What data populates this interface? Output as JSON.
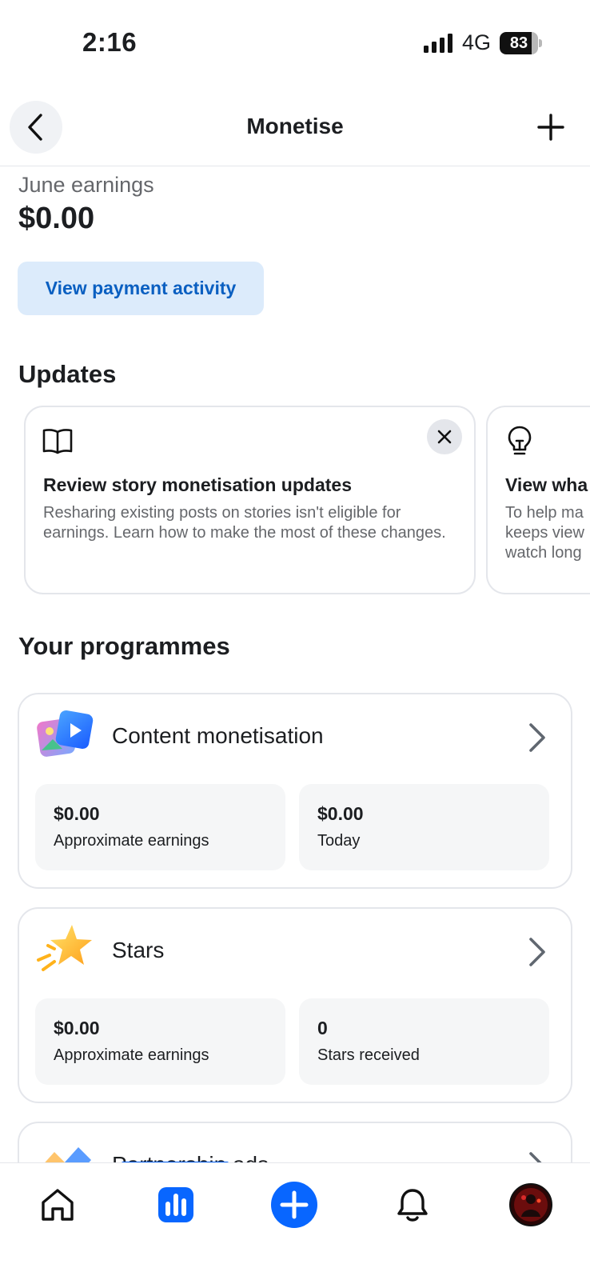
{
  "status_bar": {
    "time": "2:16",
    "network": "4G",
    "battery": "83",
    "battery_level_percent": 83
  },
  "header": {
    "title": "Monetise",
    "back_icon": "chevron-left-icon",
    "add_icon": "plus-icon"
  },
  "earnings": {
    "label": "June earnings",
    "value": "$0.00",
    "button_label": "View payment activity"
  },
  "updates": {
    "title": "Updates",
    "cards": [
      {
        "icon": "book-icon",
        "title": "Review story monetisation updates",
        "body": "Resharing existing posts on stories isn't eligible for earnings. Learn how to make the most of these changes."
      },
      {
        "icon": "lightbulb-icon",
        "title": "View wha",
        "body": "To help ma\nkeeps view\nwatch long"
      }
    ]
  },
  "programmes": {
    "title": "Your programmes",
    "items": [
      {
        "name": "Content monetisation",
        "icon": "content-monetisation-icon",
        "stats": [
          {
            "value": "$0.00",
            "label": "Approximate earnings"
          },
          {
            "value": "$0.00",
            "label": "Today"
          }
        ]
      },
      {
        "name": "Stars",
        "icon": "star-icon",
        "stats": [
          {
            "value": "$0.00",
            "label": "Approximate earnings"
          },
          {
            "value": "0",
            "label": "Stars received"
          }
        ]
      },
      {
        "name": "Partnership ads",
        "icon": "partnership-ads-icon"
      }
    ]
  },
  "bottom_nav": {
    "items": [
      "home-icon",
      "insights-icon",
      "create-icon",
      "notifications-icon",
      "profile-avatar"
    ],
    "active": "insights-icon"
  },
  "colors": {
    "accent": "#0866ff",
    "link": "#0a5fc1",
    "button_bg": "#dcebfb",
    "card_border": "#e4e6eb",
    "stat_bg": "#f5f6f7"
  }
}
